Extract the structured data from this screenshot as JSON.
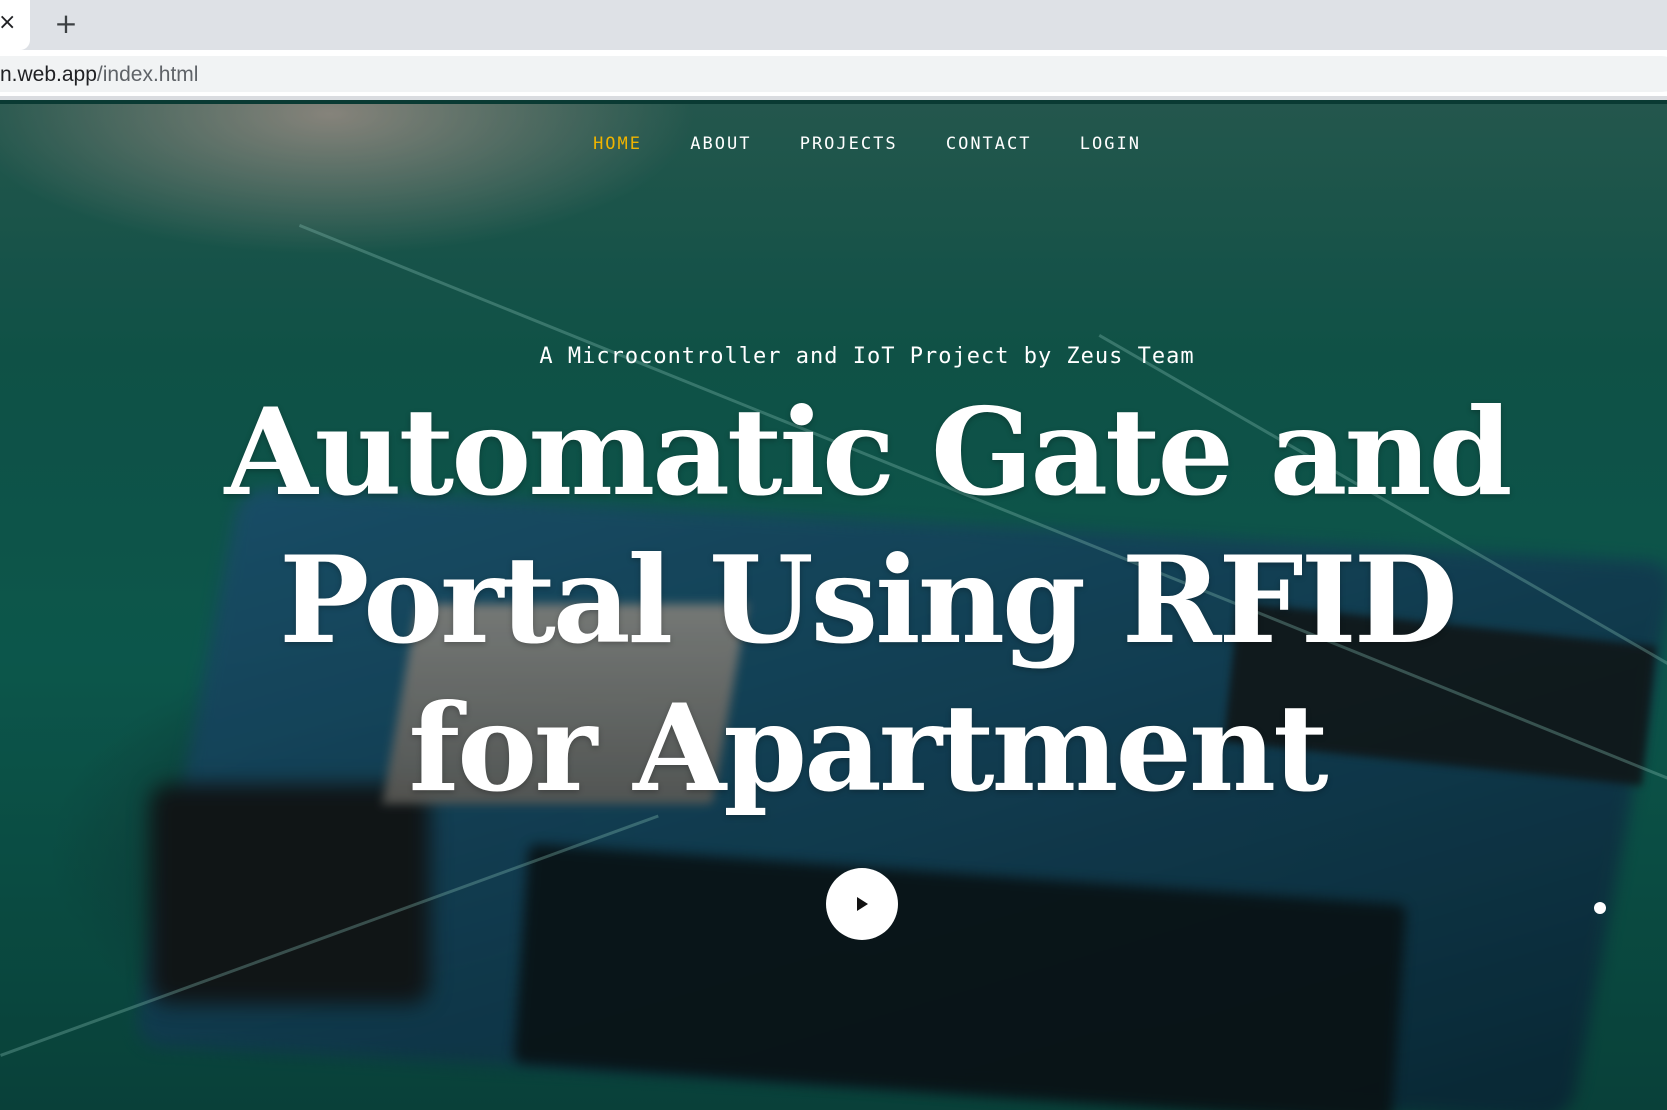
{
  "browser": {
    "tab_close_glyph": "×",
    "new_tab_glyph": "+",
    "url_host": "n.web.app",
    "url_path": "/index.html"
  },
  "nav": {
    "items": [
      {
        "label": "HOME",
        "active": true
      },
      {
        "label": "ABOUT",
        "active": false
      },
      {
        "label": "PROJECTS",
        "active": false
      },
      {
        "label": "CONTACT",
        "active": false
      },
      {
        "label": "LOGIN",
        "active": false
      }
    ],
    "active_color": "#f0b400"
  },
  "hero": {
    "subtitle": "A Microcontroller and IoT Project by Zeus Team",
    "title": "Automatic Gate and Portal Using RFID for Apartment",
    "play_icon": "play-icon"
  }
}
